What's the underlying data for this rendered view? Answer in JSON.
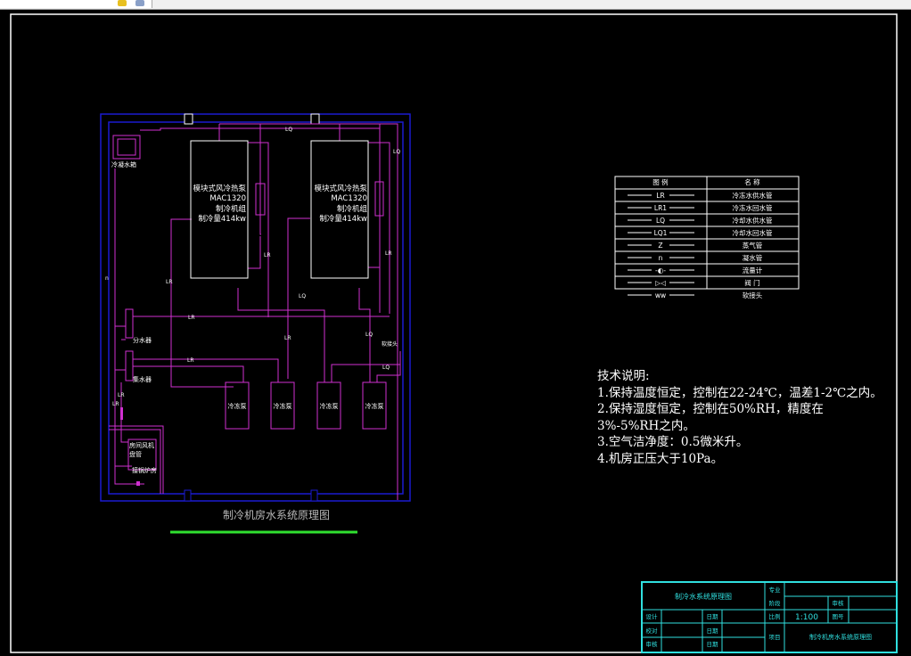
{
  "toolbar": {
    "icons": [
      "layer-icon",
      "cube-icon"
    ]
  },
  "drawing": {
    "title": "制冷机房水系统原理图",
    "cold_tank": "冷凝水箱",
    "chillers": [
      {
        "lines": [
          "模块式风冷热泵",
          "MAC1320",
          "制冷机组",
          "制冷量414kw"
        ]
      },
      {
        "lines": [
          "模块式风冷热泵",
          "MAC1320",
          "制冷机组",
          "制冷量414kw"
        ]
      }
    ],
    "pumps": [
      "冷冻泵",
      "冷冻泵",
      "冷冻泵",
      "冷冻泵"
    ],
    "supply_manifold": "分水器",
    "return_manifold": "集水器",
    "ac_room": [
      "房间风机",
      "盘管"
    ],
    "boiler_room": "接锅炉房",
    "pipe_labels": {
      "lr": "LR",
      "lr1": "LR1",
      "lq": "LQ",
      "lq1": "LQ1",
      "n": "n",
      "soft": "软接头"
    }
  },
  "legend": {
    "headers": [
      "图    例",
      "名    称"
    ],
    "rows": [
      {
        "symbol": "LR",
        "name": "冷冻水供水管"
      },
      {
        "symbol": "LR1",
        "name": "冷冻水回水管"
      },
      {
        "symbol": "LQ",
        "name": "冷却水供水管"
      },
      {
        "symbol": "LQ1",
        "name": "冷却水回水管"
      },
      {
        "symbol": "Z",
        "name": "蒸气管"
      },
      {
        "symbol": "n",
        "name": "凝水管"
      },
      {
        "symbol": "flowmeter",
        "name": "流量计"
      },
      {
        "symbol": "valve",
        "name": "阀    门"
      },
      {
        "symbol": "soft-joint",
        "name": "软接头"
      }
    ]
  },
  "notes": {
    "title": "技术说明:",
    "items": [
      "1.保持温度恒定，控制在22-24℃，温差1-2℃之内。",
      "2.保持湿度恒定，控制在50%RH，精度在3%-5%RH之内。",
      "3.空气洁净度：0.5微米升。",
      "4.机房正压大于10Pa。"
    ]
  },
  "title_block": {
    "drawing_name": "制冷水系统原理图",
    "designer": "设计",
    "checker": "校对",
    "reviewer": "审核",
    "date": "日期",
    "major": "专业",
    "stage": "阶段",
    "audit": "审核",
    "scale_label": "比例",
    "scale": "1:100",
    "drawing_no": "图号",
    "project_label": "项目",
    "project": "制冷机房水系统原理图"
  },
  "colors": {
    "pipe": "#d030d0",
    "wall": "#1a1ad0",
    "frame": "#ffffff",
    "titleblock": "#30e0e0",
    "underline": "#30e030"
  }
}
